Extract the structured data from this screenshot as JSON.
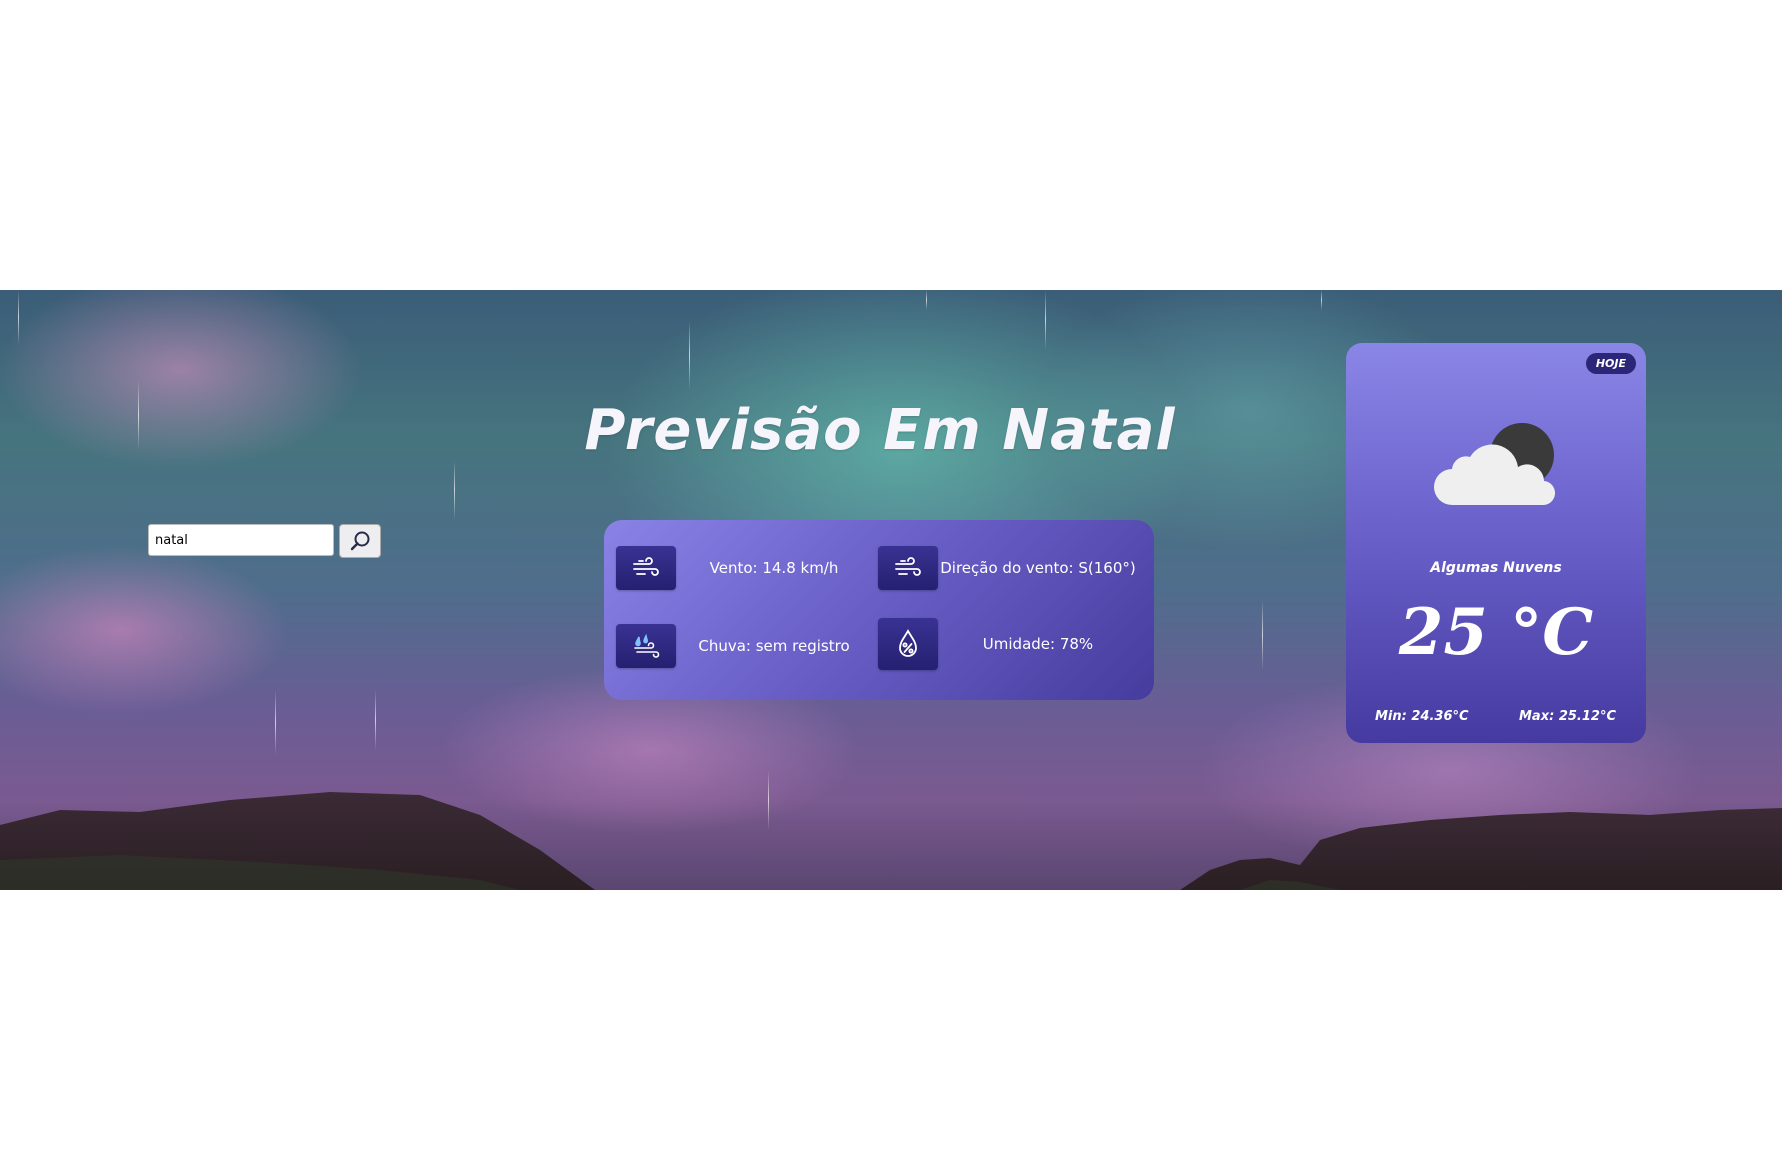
{
  "search": {
    "value": "natal",
    "button_icon": "search-icon"
  },
  "header": {
    "title": "Previsão Em Natal"
  },
  "details": {
    "wind": {
      "icon": "wind-icon",
      "text": "Vento: 14.8 km/h"
    },
    "wind_direction": {
      "icon": "wind-direction-icon",
      "text": "Direção do vento: S(160°)"
    },
    "rain": {
      "icon": "rain-icon",
      "text": "Chuva: sem registro"
    },
    "humidity": {
      "icon": "humidity-icon",
      "text": "Umidade: 78%"
    }
  },
  "today": {
    "badge": "HOJE",
    "icon": "partly-cloudy-icon",
    "condition": "Algumas Nuvens",
    "temperature": "25 °C",
    "min": "Min: 24.36°C",
    "max": "Max: 25.12°C"
  },
  "colors": {
    "card_top": "#8a86e6",
    "card_bottom": "#453aa0",
    "icon_tile": "#2c2678"
  }
}
